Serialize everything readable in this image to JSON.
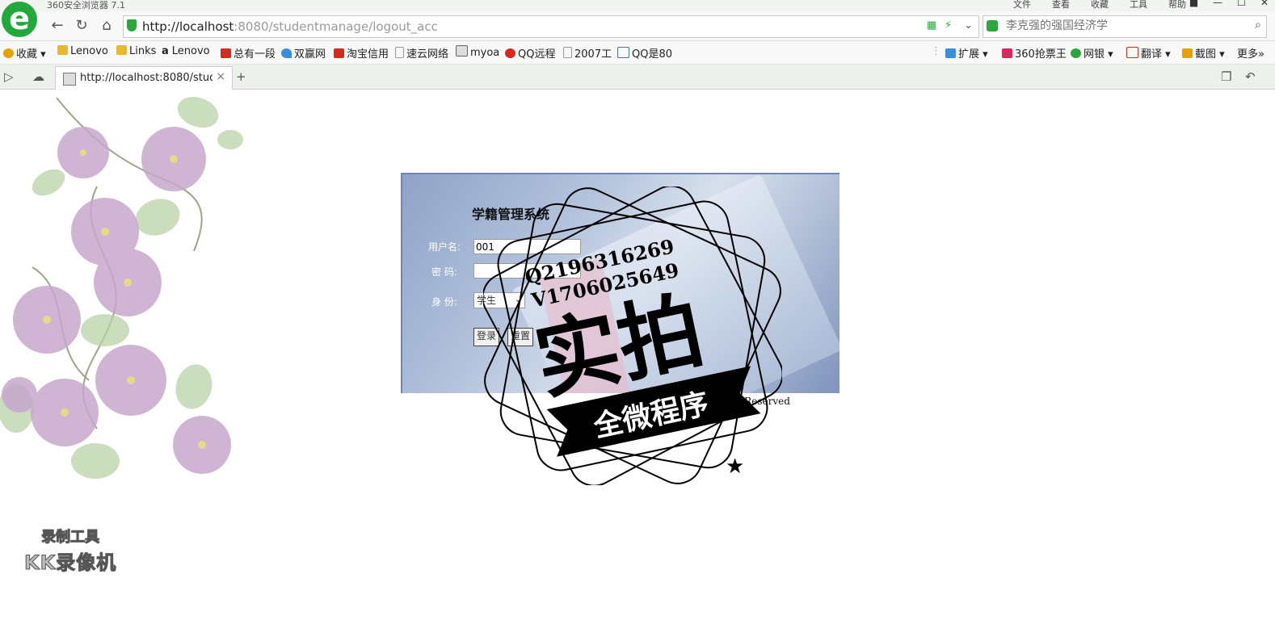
{
  "titlebar": {
    "app_title": "360安全浏览器 7.1",
    "menu": [
      "文件",
      "查看",
      "收藏",
      "工具",
      "帮助"
    ]
  },
  "address_bar": {
    "url_host": "http://localhost",
    "url_path": ":8080/studentmanage/logout_acc",
    "search_placeholder": "李克强的强国经济学"
  },
  "bookmarks": [
    {
      "label": "收藏",
      "icon": "star-icon",
      "color": "#e8a100"
    },
    {
      "label": "Lenovo",
      "icon": "folder-icon",
      "color": "#e8b830"
    },
    {
      "label": "Links",
      "icon": "folder-icon",
      "color": "#e8b830"
    },
    {
      "label": "Lenovo",
      "icon": "amazon-icon",
      "color": "#222222"
    },
    {
      "label": "总有一段",
      "icon": "headline-icon",
      "color": "#d62a1f"
    },
    {
      "label": "双赢网",
      "icon": "bird-icon",
      "color": "#3a8fd8"
    },
    {
      "label": "淘宝信用",
      "icon": "taobao-icon",
      "color": "#d62a1f"
    },
    {
      "label": "速云网络",
      "icon": "page-icon",
      "color": "#999999"
    },
    {
      "label": "myoa",
      "icon": "image-icon",
      "color": "#666666"
    },
    {
      "label": "QQ远程",
      "icon": "qq-icon",
      "color": "#d62a1f"
    },
    {
      "label": "2007工",
      "icon": "page-icon",
      "color": "#999999"
    },
    {
      "label": "QQ是80",
      "icon": "bank-icon",
      "color": "#4a6fa5"
    }
  ],
  "toolbar_right": [
    {
      "label": "扩展",
      "icon": "puzzle-icon",
      "color": "#3a8fd8"
    },
    {
      "label": "360抢票王",
      "icon": "ticket-icon",
      "color": "#d62a5f"
    },
    {
      "label": "网银",
      "icon": "yuan-icon",
      "color": "#2aa83e"
    },
    {
      "label": "翻译",
      "icon": "translate-icon",
      "color": "#d62a1f"
    },
    {
      "label": "截图",
      "icon": "scissors-icon",
      "color": "#e8a100"
    },
    {
      "label": "更多",
      "icon": "",
      "color": "#333333"
    }
  ],
  "tab": {
    "title": "http://localhost:8080/student"
  },
  "login": {
    "system_title": "学籍管理系统",
    "username_label": "用户名:",
    "username_value": "001",
    "password_label": "密  码:",
    "password_value": "",
    "identity_label": "身  份:",
    "identity_value": "学生",
    "login_button": "登录",
    "reset_button": "重置"
  },
  "copyright_fragment": "ghts Reserved",
  "stamp": {
    "line1": "Q2196316269",
    "line2": "V1706025649",
    "main": "实拍",
    "ribbon": "全微程序"
  },
  "recorder_badge": {
    "line1": "录制工具",
    "line2": "KK录像机"
  }
}
